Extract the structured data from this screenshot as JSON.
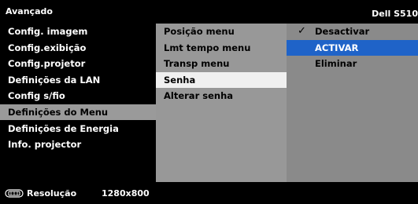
{
  "header": {
    "title": "Avançado",
    "model": "Dell S510"
  },
  "menu": [
    "Config. imagem",
    "Config.exibição",
    "Config.projetor",
    "Definições da LAN",
    "Config s/fio",
    "Definições do Menu",
    "Definições de Energia",
    "Info. projector"
  ],
  "menu_selected_index": 5,
  "submenu": [
    "Posição menu",
    "Lmt tempo menu",
    "Transp menu",
    "Senha",
    "Alterar senha"
  ],
  "submenu_selected_index": 3,
  "options": [
    {
      "label": "Desactivar",
      "checked": true
    },
    {
      "label": "ACTIVAR",
      "checked": false
    },
    {
      "label": "Eliminar",
      "checked": false
    }
  ],
  "options_highlight_index": 1,
  "check_glyph": "✓",
  "footer": {
    "icon": "resolution-icon",
    "label": "Resolução",
    "value": "1280x800"
  },
  "colors": {
    "highlight": "#1f63c8",
    "menu_selected": "#9a9a9a",
    "submenu_selected": "#f0f0f0"
  }
}
